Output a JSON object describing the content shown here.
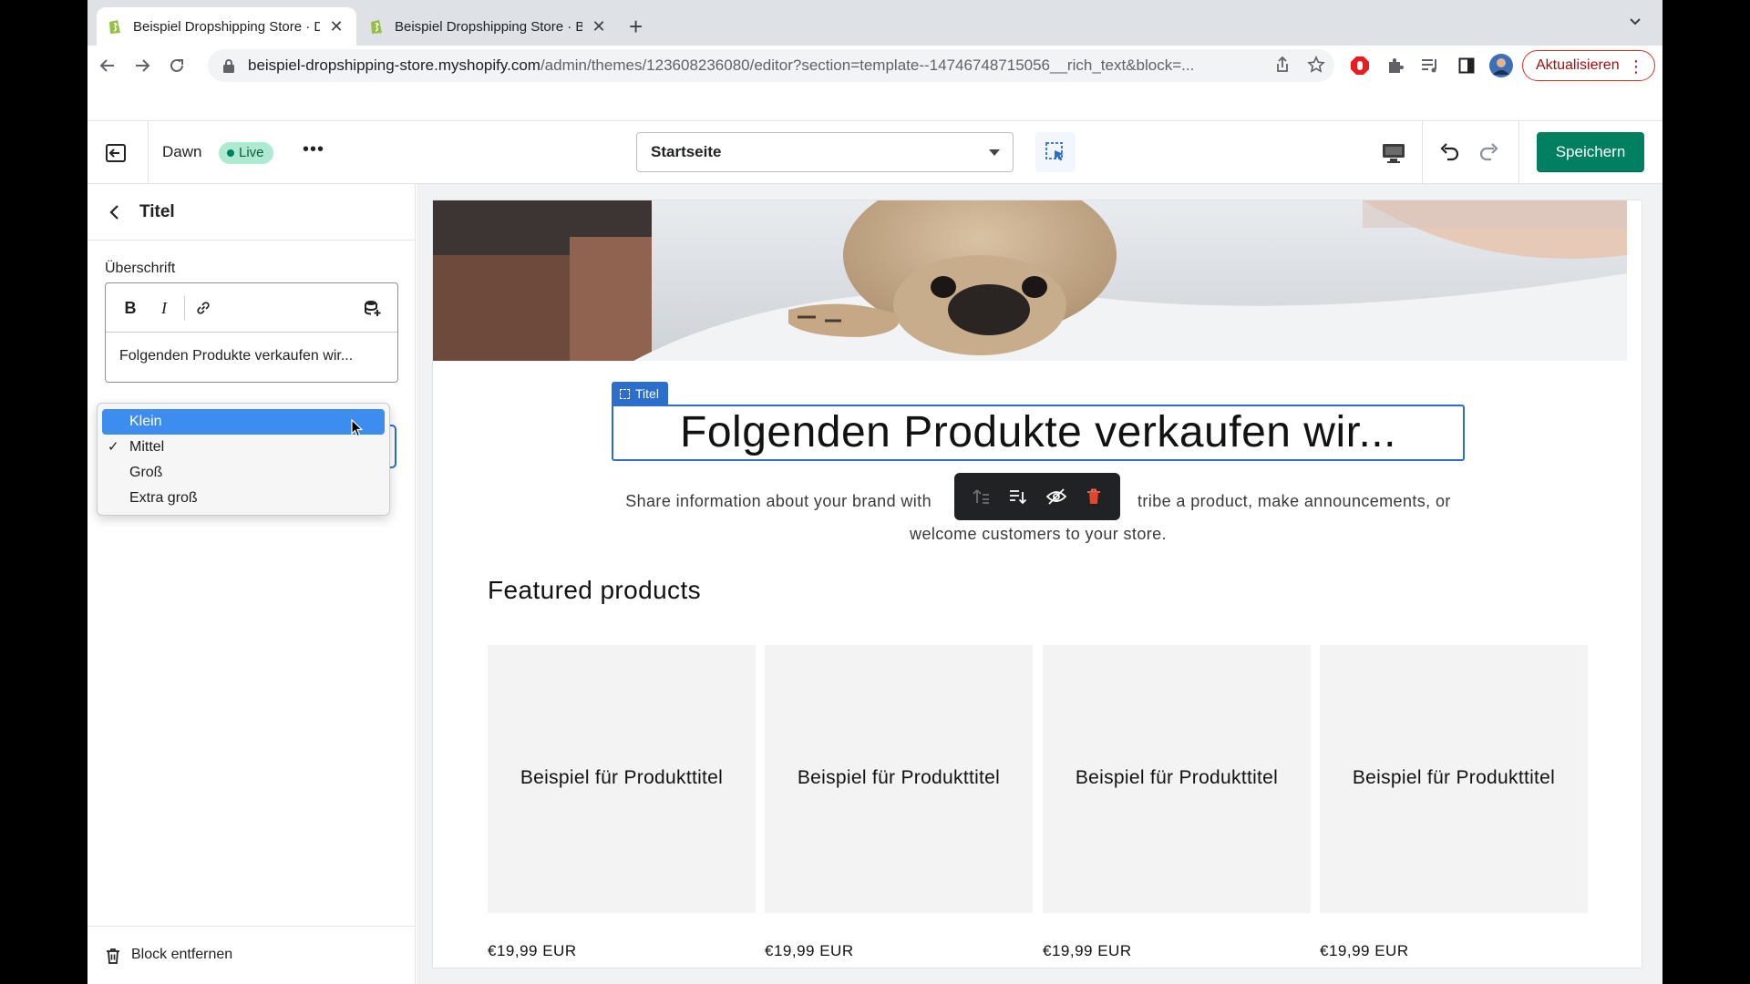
{
  "browser": {
    "tabs": [
      {
        "title": "Beispiel Dropshipping Store · Designs · Shopify",
        "active": true
      },
      {
        "title": "Beispiel Dropshipping Store · Bearbeiten · Shopify",
        "active": false
      }
    ],
    "url_host": "beispiel-dropshipping-store.myshopify.com",
    "url_path": "/admin/themes/123608236080/editor?section=template--14746748715056__rich_text&block=...",
    "update_label": "Aktualisieren",
    "icons": {
      "back": "arrow-left-icon",
      "forward": "arrow-right-icon",
      "reload": "reload-icon",
      "lock": "lock-icon",
      "share": "share-icon",
      "bookmark": "star-icon"
    }
  },
  "editor": {
    "theme_name": "Dawn",
    "live_badge": "Live",
    "more_label": "•••",
    "template_select": "Startseite",
    "save_label": "Speichern"
  },
  "sidebar": {
    "title": "Titel",
    "heading_label": "Überschrift",
    "heading_value": "Folgenden Produkte verkaufen wir...",
    "size_options": [
      {
        "label": "Klein",
        "highlighted": true,
        "checked": false
      },
      {
        "label": "Mittel",
        "highlighted": false,
        "checked": true
      },
      {
        "label": "Groß",
        "highlighted": false,
        "checked": false
      },
      {
        "label": "Extra groß",
        "highlighted": false,
        "checked": false
      }
    ],
    "remove_block_label": "Block entfernen"
  },
  "preview": {
    "block_label": "Titel",
    "title": "Folgenden Produkte verkaufen wir...",
    "text_line1_a": "Share information about your brand with",
    "text_line1_b": "tribe a product, make announcements, or",
    "text_line2": "welcome customers to your store.",
    "featured_heading": "Featured products",
    "products": [
      {
        "title": "Beispiel für Produkttitel",
        "price": "€19,99 EUR"
      },
      {
        "title": "Beispiel für Produkttitel",
        "price": "€19,99 EUR"
      },
      {
        "title": "Beispiel für Produkttitel",
        "price": "€19,99 EUR"
      },
      {
        "title": "Beispiel für Produkttitel",
        "price": "€19,99 EUR"
      }
    ]
  },
  "colors": {
    "accent": "#2c6ecb",
    "save": "#008060",
    "live_badge_bg": "#aee9d1",
    "dropdown_highlight": "#3d8cf0"
  }
}
